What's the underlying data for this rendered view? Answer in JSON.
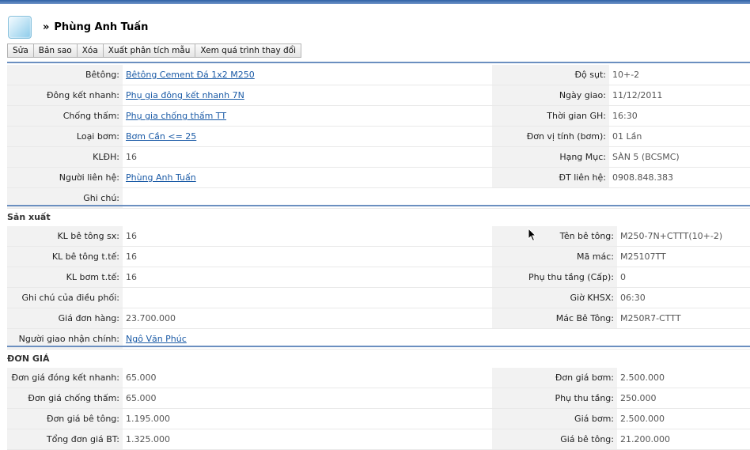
{
  "header": {
    "arrow": "»",
    "title": "Phùng Anh Tuấn"
  },
  "toolbar": {
    "buttons": [
      "Sửa",
      "Bản sao",
      "Xóa",
      "Xuất phân tích mẫu",
      "Xem quá trình thay đổi"
    ]
  },
  "info": {
    "rows": [
      {
        "l1": "Bêtông:",
        "v1": "Bêtông Cement Đá 1x2 M250",
        "l2": "Độ sụt:",
        "v2": "10+-2"
      },
      {
        "l1": "Đông kết nhanh:",
        "v1": "Phụ gia đông kết nhanh 7N",
        "l2": "Ngày giao:",
        "v2": "11/12/2011"
      },
      {
        "l1": "Chống thấm:",
        "v1": "Phụ gia chống thấm TT",
        "l2": "Thời gian GH:",
        "v2": "16:30"
      },
      {
        "l1": "Loại bơm:",
        "v1": "Bơm Cần <= 25",
        "l2": "Đơn vị tính (bơm):",
        "v2": "01 Lần"
      },
      {
        "l1": "KLĐH:",
        "v1": "16",
        "l2": "Hạng Mục:",
        "v2": "SÀN 5 (BCSMC)"
      },
      {
        "l1": "Người liên hệ:",
        "v1": "Phùng Anh Tuấn",
        "l2": "ĐT liên hệ:",
        "v2": "0908.848.383"
      },
      {
        "l1": "Ghi chú:",
        "v1": "",
        "l2": "",
        "v2": ""
      }
    ]
  },
  "production": {
    "title": "Sản xuất",
    "rows": [
      {
        "l1": "KL bê tông sx:",
        "v1": "16",
        "l2": "Tên bê tông:",
        "v2": "M250-7N+CTTT(10+-2)"
      },
      {
        "l1": "KL bê tông t.tế:",
        "v1": "16",
        "l2": "Mã mác:",
        "v2": "M25107TT"
      },
      {
        "l1": "KL bơm t.tế:",
        "v1": "16",
        "l2": "Phụ thu tầng (Cấp):",
        "v2": "0"
      },
      {
        "l1": "Ghi chú của điều phối:",
        "v1": "",
        "l2": "Giờ KHSX:",
        "v2": "06:30"
      },
      {
        "l1": "Giá đơn hàng:",
        "v1": "23.700.000",
        "l2": "Mác Bê Tông:",
        "v2": "M250R7-CTTT"
      },
      {
        "l1": "Người giao nhận chính:",
        "v1": "Ngô Văn Phúc",
        "l2": "",
        "v2": ""
      }
    ]
  },
  "pricing": {
    "title": "ĐƠN GIÁ",
    "rows": [
      {
        "l1": "Đơn giá đóng kết nhanh:",
        "v1": "65.000",
        "l2": "Đơn giá bơm:",
        "v2": "2.500.000"
      },
      {
        "l1": "Đơn giá chống thấm:",
        "v1": "65.000",
        "l2": "Phụ thu tầng:",
        "v2": "250.000"
      },
      {
        "l1": "Đơn giá bê tông:",
        "v1": "1.195.000",
        "l2": "Giá bơm:",
        "v2": "2.500.000"
      },
      {
        "l1": "Tổng đơn giá BT:",
        "v1": "1.325.000",
        "l2": "Giá bê tông:",
        "v2": "21.200.000"
      }
    ]
  }
}
